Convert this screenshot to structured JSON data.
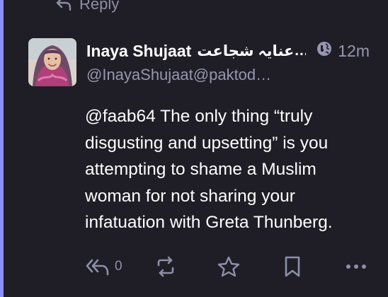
{
  "thread": {
    "reply_label": "Reply"
  },
  "post": {
    "author": {
      "display_name": "Inaya Shujaat",
      "display_name_urdu": "عنایہ شجاعت",
      "name_ellipsis": "…",
      "handle": "@InayaShujaat@paktod…"
    },
    "visibility_icon": "globe-icon",
    "time": "12m",
    "mention": "@faab64",
    "lines": [
      "@faab64 The only thing “truly",
      "disgusting and upsetting” is you",
      "attempting to shame a Muslim",
      "woman for not sharing your",
      "infatuation with Greta Thunberg."
    ]
  },
  "actions": {
    "reply_icon": "reply-all-icon",
    "reply_count": "0",
    "boost_icon": "boost-icon",
    "favourite_icon": "star-icon",
    "bookmark_icon": "bookmark-icon",
    "more_icon": "more-icon"
  },
  "colors": {
    "background": "#1f1e27",
    "accent_rail": "#8c8dff",
    "text_primary": "#ffffff",
    "text_secondary": "#9696b0"
  }
}
